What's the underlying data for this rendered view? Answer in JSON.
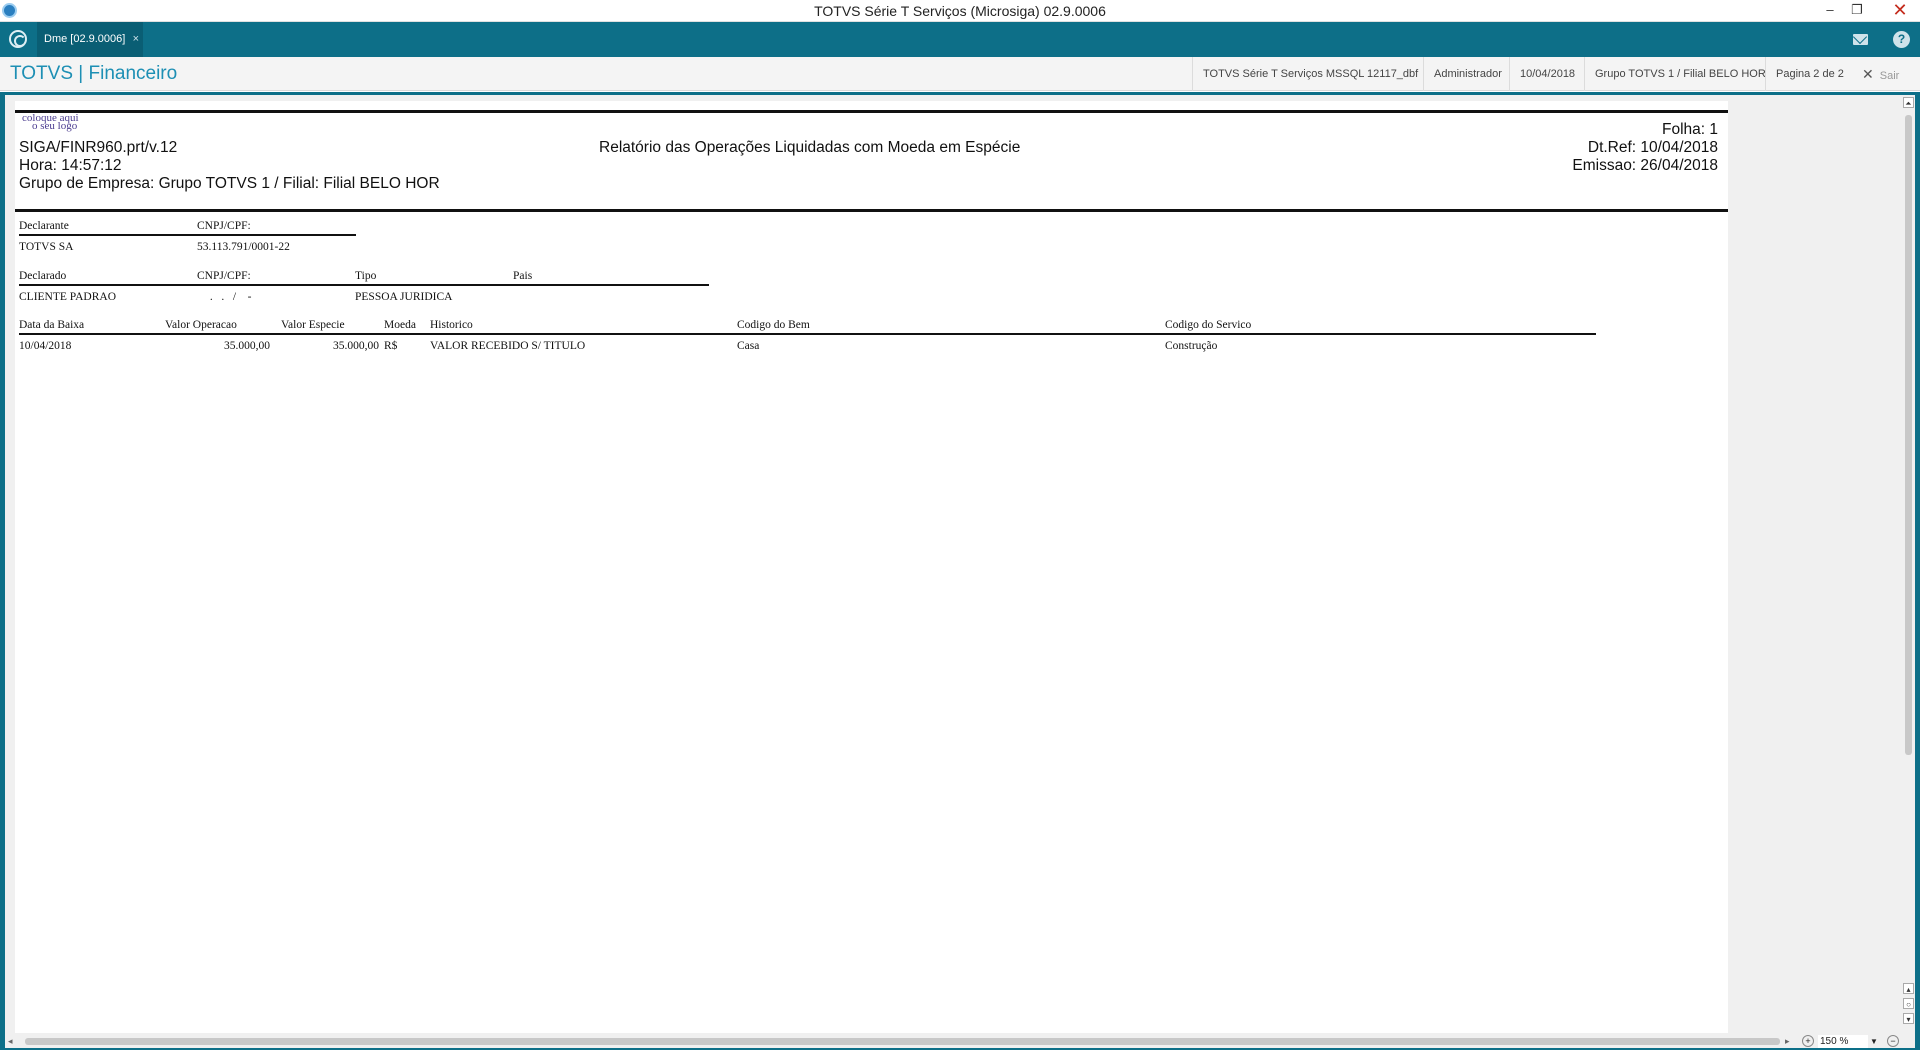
{
  "window": {
    "title": "TOTVS Série T Serviços (Microsiga) 02.9.0006",
    "min_glyph": "–",
    "max_glyph": "❐",
    "close_glyph": "✕"
  },
  "tabs": [
    {
      "label": "Dme [02.9.0006]",
      "close_glyph": "×"
    }
  ],
  "header": {
    "brand": "TOTVS | Financeiro",
    "environment": "TOTVS Série T Serviços MSSQL 12117_dbf",
    "user": "Administrador",
    "date": "10/04/2018",
    "company": "Grupo TOTVS 1 / Filial BELO HOR",
    "pagination": "Pagina 2 de 2",
    "exit_label": "Sair"
  },
  "report": {
    "logo_line1": "coloque aqui",
    "logo_line2": "o seu logo",
    "program": "SIGA/FINR960.prt/v.12",
    "time": "Hora: 14:57:12",
    "company_group": "Grupo de Empresa: Grupo TOTVS 1 / Filial: Filial BELO HOR",
    "title": "Relatório das Operações Liquidadas com Moeda em Espécie",
    "folha": "Folha:    1",
    "dtref": "Dt.Ref: 10/04/2018",
    "emissao": "Emissao: 26/04/2018",
    "declarante_section": {
      "headers": [
        "Declarante",
        "CNPJ/CPF:"
      ],
      "values": [
        "TOTVS SA",
        "53.113.791/0001-22"
      ]
    },
    "declarado_section": {
      "headers": [
        "Declarado",
        "CNPJ/CPF:",
        "Tipo",
        "Pais"
      ],
      "values": [
        "CLIENTE PADRAO",
        " .   .   /    -",
        "PESSOA JURIDICA",
        ""
      ]
    },
    "operations": {
      "headers": [
        "Data da Baixa",
        "Valor Operacao",
        "Valor Especie",
        "Moeda",
        "Historico",
        "Codigo do Bem",
        "Codigo do Servico"
      ],
      "rows": [
        [
          "10/04/2018",
          "35.000,00",
          "35.000,00",
          "R$",
          "VALOR RECEBIDO S/ TITULO",
          "Casa",
          "Construção"
        ]
      ]
    }
  },
  "viewer": {
    "zoom": "150 %"
  }
}
